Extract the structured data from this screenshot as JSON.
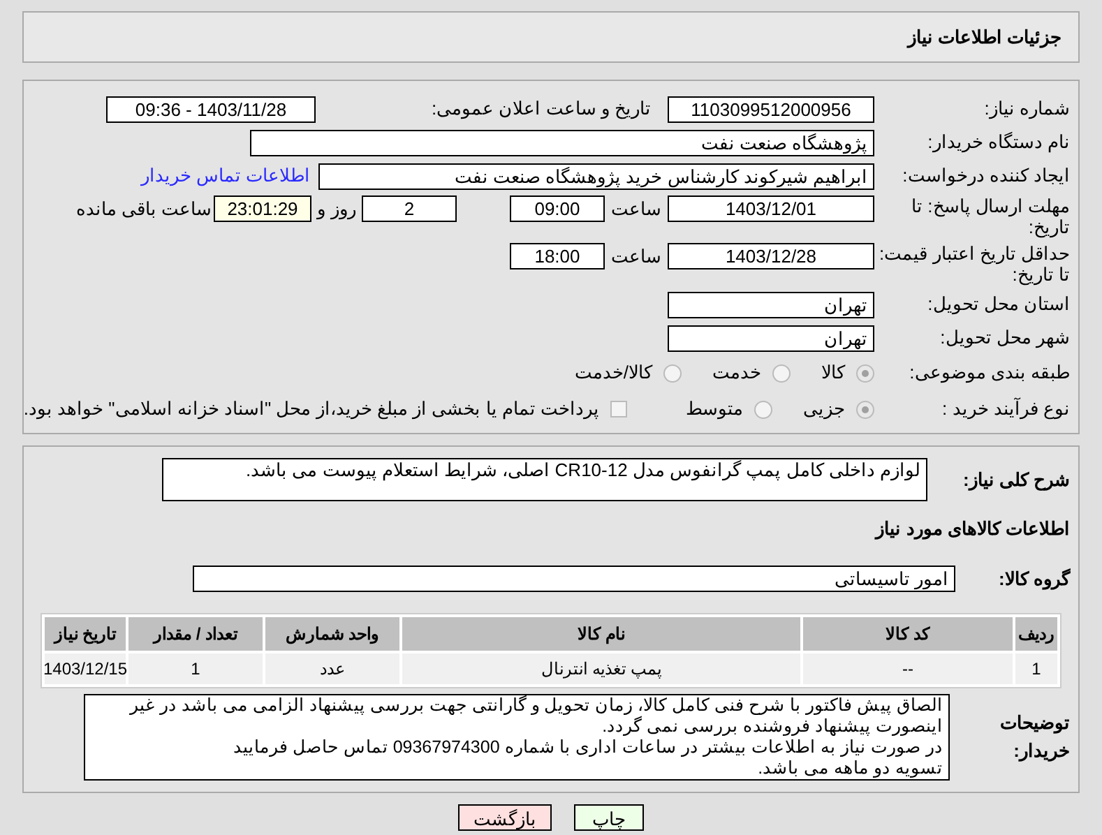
{
  "header": {
    "title": "جزئیات اطلاعات نیاز"
  },
  "need_number": {
    "label": "شماره نیاز:",
    "value": "1103099512000956"
  },
  "announce": {
    "label": "تاریخ و ساعت اعلان عمومی:",
    "value": "1403/11/28 - 09:36"
  },
  "buyer_org": {
    "label": "نام دستگاه خریدار:",
    "value": "پژوهشگاه صنعت نفت"
  },
  "requester": {
    "label": "ایجاد کننده درخواست:",
    "value": "ابراهیم شیرکوند کارشناس خرید پژوهشگاه صنعت نفت",
    "link": "اطلاعات تماس خریدار"
  },
  "deadline": {
    "label": "مهلت ارسال پاسخ: تا تاریخ:",
    "date": "1403/12/01",
    "time_label": "ساعت",
    "time": "09:00",
    "days": "2",
    "days_label": "روز و",
    "remaining": "23:01:29",
    "remaining_label": "ساعت باقی مانده"
  },
  "validity": {
    "label": "حداقل تاریخ اعتبار قیمت: تا تاریخ:",
    "date": "1403/12/28",
    "time_label": "ساعت",
    "time": "18:00"
  },
  "province": {
    "label": "استان محل تحویل:",
    "value": "تهران"
  },
  "city": {
    "label": "شهر محل تحویل:",
    "value": "تهران"
  },
  "category": {
    "label": "طبقه بندی موضوعی:",
    "options": [
      {
        "label": "کالا",
        "selected": true
      },
      {
        "label": "خدمت",
        "selected": false
      },
      {
        "label": "کالا/خدمت",
        "selected": false
      }
    ]
  },
  "purchase": {
    "label": "نوع فرآیند خرید :",
    "options": [
      {
        "label": "جزیی",
        "selected": true
      },
      {
        "label": "متوسط",
        "selected": false
      }
    ],
    "payment": {
      "label": "پرداخت تمام یا بخشی از مبلغ خرید،از محل \"اسناد خزانه اسلامی\" خواهد بود.",
      "checked": false
    }
  },
  "description": {
    "label": "شرح کلی نیاز:",
    "value": "لوازم داخلی کامل پمپ گرانفوس مدل CR10-12 اصلی، شرایط استعلام پیوست می باشد."
  },
  "goods_heading": "اطلاعات کالاهای مورد نیاز",
  "goods_group": {
    "label": "گروه کالا:",
    "value": "امور تاسیساتی"
  },
  "table": {
    "columns": [
      "ردیف",
      "کد کالا",
      "نام کالا",
      "واحد شمارش",
      "تعداد / مقدار",
      "تاریخ نیاز"
    ],
    "rows": [
      [
        "1",
        "--",
        "پمپ تغذیه انترنال",
        "عدد",
        "1",
        "1403/12/15"
      ]
    ]
  },
  "buyer_notes": {
    "label": "توضیحات خریدار:",
    "lines": [
      "الصاق پیش فاکتور با شرح فنی کامل کالا، زمان تحویل و گارانتی جهت بررسی پیشنهاد الزامی می باشد در غیر اینصورت پیشنهاد فروشنده بررسی نمی گردد.",
      "در صورت نیاز به اطلاعات بیشتر در ساعات اداری با شماره 09367974300 تماس حاصل فرمایید",
      "تسویه دو ماهه می باشد."
    ]
  },
  "buttons": [
    {
      "label": "چاپ",
      "kind": "print"
    },
    {
      "label": "بازگشت",
      "kind": "back"
    }
  ]
}
